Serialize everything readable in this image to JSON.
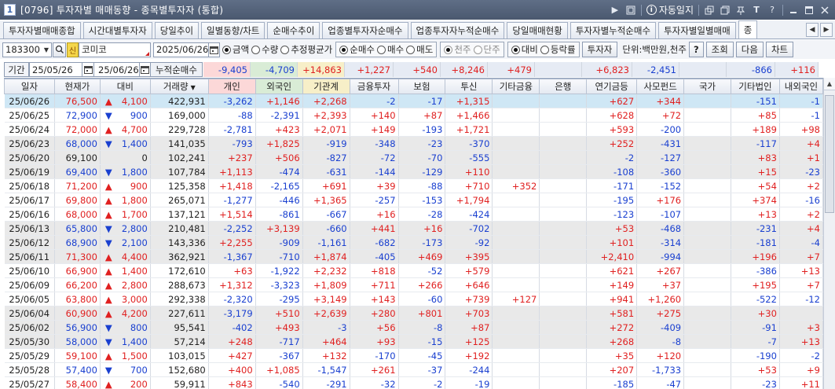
{
  "window": {
    "number": "1",
    "title": "[0796] 투자자별 매매동향 - 종목별투자자 (통합)",
    "auto_label": "자동일지"
  },
  "tabs": [
    "투자자별매매종합",
    "시간대별투자자",
    "당일추이",
    "일별동향/차트",
    "순매수추이",
    "업종별투자자순매수",
    "업종투자자누적순매수",
    "당일매매현황",
    "투자자별누적순매수",
    "투자자별일별매매",
    "종"
  ],
  "controls": {
    "code": "183300",
    "stock_badge": "신",
    "stock_name": "코미코",
    "date": "2025/06/26",
    "radio_amount": "금액",
    "radio_qty": "수량",
    "radio_est": "추정평균가",
    "radio_net": "순매수",
    "radio_buy": "매수",
    "radio_sell": "매도",
    "radio_k1": "천주",
    "radio_k2": "단주",
    "radio_cmp": "대비",
    "radio_rate": "등락률",
    "investor_btn": "투자자",
    "unit": "단위:백만원,천주",
    "help": "?",
    "search": "조회",
    "next": "다음",
    "chart": "차트"
  },
  "period": {
    "label": "기간",
    "from": "25/05/26",
    "to": "25/06/26",
    "cum_label": "누적순매수"
  },
  "totals": [
    "-9,405",
    "-4,709",
    "+14,863",
    "+1,227",
    "+540",
    "+8,246",
    "+479",
    "",
    "+6,823",
    "-2,451",
    "",
    "-866",
    "+116"
  ],
  "columns": [
    "일자",
    "현재가",
    "대비",
    "거래량",
    "개인",
    "외국인",
    "기관계",
    "금융투자",
    "보험",
    "투신",
    "기타금융",
    "은행",
    "연기금등",
    "사모펀드",
    "국가",
    "기타법인",
    "내외국인"
  ],
  "rows": [
    [
      "25/06/26",
      "76,500",
      "up",
      "4,100",
      "422,931",
      "-3,262",
      "+1,146",
      "+2,268",
      "-2",
      "-17",
      "+1,315",
      "",
      "",
      "+627",
      "+344",
      "",
      "-151",
      "-1"
    ],
    [
      "25/06/25",
      "72,900",
      "down",
      "900",
      "169,000",
      "-88",
      "-2,391",
      "+2,393",
      "+140",
      "+87",
      "+1,466",
      "",
      "",
      "+628",
      "+72",
      "",
      "+85",
      "-1"
    ],
    [
      "25/06/24",
      "72,000",
      "up",
      "4,700",
      "229,728",
      "-2,781",
      "+423",
      "+2,071",
      "+149",
      "-193",
      "+1,721",
      "",
      "",
      "+593",
      "-200",
      "",
      "+189",
      "+98"
    ],
    [
      "25/06/23",
      "68,000",
      "down",
      "1,400",
      "141,035",
      "-793",
      "+1,825",
      "-919",
      "-348",
      "-23",
      "-370",
      "",
      "",
      "+252",
      "-431",
      "",
      "-117",
      "+4"
    ],
    [
      "25/06/20",
      "69,100",
      "flat",
      "0",
      "102,241",
      "+237",
      "+506",
      "-827",
      "-72",
      "-70",
      "-555",
      "",
      "",
      "-2",
      "-127",
      "",
      "+83",
      "+1"
    ],
    [
      "25/06/19",
      "69,400",
      "down",
      "1,800",
      "107,784",
      "+1,113",
      "-474",
      "-631",
      "-144",
      "-129",
      "+110",
      "",
      "",
      "-108",
      "-360",
      "",
      "+15",
      "-23"
    ],
    [
      "25/06/18",
      "71,200",
      "up",
      "900",
      "125,358",
      "+1,418",
      "-2,165",
      "+691",
      "+39",
      "-88",
      "+710",
      "+352",
      "",
      "-171",
      "-152",
      "",
      "+54",
      "+2"
    ],
    [
      "25/06/17",
      "69,800",
      "up",
      "1,800",
      "265,071",
      "-1,277",
      "-446",
      "+1,365",
      "-257",
      "-153",
      "+1,794",
      "",
      "",
      "-195",
      "+176",
      "",
      "+374",
      "-16"
    ],
    [
      "25/06/16",
      "68,000",
      "up",
      "1,700",
      "137,121",
      "+1,514",
      "-861",
      "-667",
      "+16",
      "-28",
      "-424",
      "",
      "",
      "-123",
      "-107",
      "",
      "+13",
      "+2"
    ],
    [
      "25/06/13",
      "65,800",
      "down",
      "2,800",
      "210,481",
      "-2,252",
      "+3,139",
      "-660",
      "+441",
      "+16",
      "-702",
      "",
      "",
      "+53",
      "-468",
      "",
      "-231",
      "+4"
    ],
    [
      "25/06/12",
      "68,900",
      "down",
      "2,100",
      "143,336",
      "+2,255",
      "-909",
      "-1,161",
      "-682",
      "-173",
      "-92",
      "",
      "",
      "+101",
      "-314",
      "",
      "-181",
      "-4"
    ],
    [
      "25/06/11",
      "71,300",
      "up",
      "4,400",
      "362,921",
      "-1,367",
      "-710",
      "+1,874",
      "-405",
      "+469",
      "+395",
      "",
      "",
      "+2,410",
      "-994",
      "",
      "+196",
      "+7"
    ],
    [
      "25/06/10",
      "66,900",
      "up",
      "1,400",
      "172,610",
      "+63",
      "-1,922",
      "+2,232",
      "+818",
      "-52",
      "+579",
      "",
      "",
      "+621",
      "+267",
      "",
      "-386",
      "+13"
    ],
    [
      "25/06/09",
      "66,200",
      "up",
      "2,800",
      "288,673",
      "+1,312",
      "-3,323",
      "+1,809",
      "+711",
      "+266",
      "+646",
      "",
      "",
      "+149",
      "+37",
      "",
      "+195",
      "+7"
    ],
    [
      "25/06/05",
      "63,800",
      "up",
      "3,000",
      "292,338",
      "-2,320",
      "-295",
      "+3,149",
      "+143",
      "-60",
      "+739",
      "+127",
      "",
      "+941",
      "+1,260",
      "",
      "-522",
      "-12"
    ],
    [
      "25/06/04",
      "60,900",
      "up",
      "4,200",
      "227,611",
      "-3,179",
      "+510",
      "+2,639",
      "+280",
      "+801",
      "+703",
      "",
      "",
      "+581",
      "+275",
      "",
      "+30",
      ""
    ],
    [
      "25/06/02",
      "56,900",
      "down",
      "800",
      "95,541",
      "-402",
      "+493",
      "-3",
      "+56",
      "-8",
      "+87",
      "",
      "",
      "+272",
      "-409",
      "",
      "-91",
      "+3"
    ],
    [
      "25/05/30",
      "58,000",
      "down",
      "1,400",
      "57,214",
      "+248",
      "-717",
      "+464",
      "+93",
      "-15",
      "+125",
      "",
      "",
      "+268",
      "-8",
      "",
      "-7",
      "+13"
    ],
    [
      "25/05/29",
      "59,100",
      "up",
      "1,500",
      "103,015",
      "+427",
      "-367",
      "+132",
      "-170",
      "-45",
      "+192",
      "",
      "",
      "+35",
      "+120",
      "",
      "-190",
      "-2"
    ],
    [
      "25/05/28",
      "57,400",
      "down",
      "700",
      "152,680",
      "+400",
      "+1,085",
      "-1,547",
      "+261",
      "-37",
      "-244",
      "",
      "",
      "+207",
      "-1,733",
      "",
      "+53",
      "+9"
    ],
    [
      "25/05/27",
      "58,400",
      "up",
      "200",
      "59,911",
      "+843",
      "-540",
      "-291",
      "-32",
      "-2",
      "-19",
      "",
      "",
      "-185",
      "-47",
      "",
      "-23",
      "+11"
    ]
  ],
  "colors": {
    "up": "#e02020",
    "down": "#1a40d0",
    "selected_row": "#cfe7f5",
    "shaded_row": "#e9e9e9",
    "header_individual": "#fcd8d8",
    "header_foreign": "#d9ecd6",
    "header_institution": "#f7efc8"
  }
}
